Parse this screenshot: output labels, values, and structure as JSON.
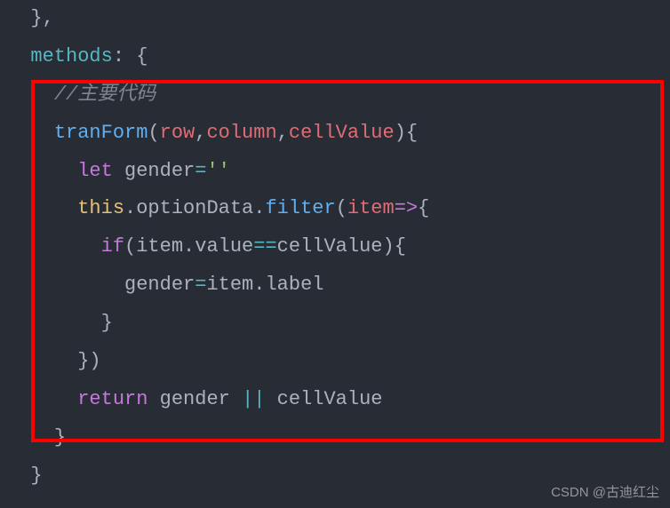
{
  "code": {
    "line0a": "  },",
    "line1": {
      "indent": "  ",
      "methods": "methods",
      "colon": ":",
      "brace": " {"
    },
    "line2": {
      "indent": "    ",
      "comment": "//主要代码"
    },
    "line3": {
      "indent": "    ",
      "func": "tranForm",
      "paren1": "(",
      "arg1": "row",
      "comma1": ",",
      "arg2": "column",
      "comma2": ",",
      "arg3": "cellValue",
      "paren2": "){"
    },
    "line4": {
      "indent": "      ",
      "let": "let",
      "sp": " ",
      "var": "gender",
      "eq": "=",
      "str": "''"
    },
    "line5": {
      "indent": "      ",
      "this": "this",
      "dot1": ".",
      "prop1": "optionData",
      "dot2": ".",
      "filter": "filter",
      "paren1": "(",
      "item": "item",
      "arrow": "=>",
      "brace": "{"
    },
    "line6": {
      "indent": "        ",
      "if": "if",
      "paren1": "(",
      "item": "item",
      "dot": ".",
      "value": "value",
      "eq": "==",
      "cell": "cellValue",
      "paren2": "){"
    },
    "line7": {
      "indent": "          ",
      "gender": "gender",
      "eq": "=",
      "item": "item",
      "dot": ".",
      "label": "label"
    },
    "line8": {
      "indent": "        ",
      "brace": "}"
    },
    "line9": {
      "indent": "      ",
      "close": "})"
    },
    "line10": {
      "indent": "      ",
      "return": "return",
      "sp": " ",
      "gender": "gender ",
      "or": "||",
      "cell": " cellValue"
    },
    "line11": {
      "indent": "    ",
      "brace": "}"
    },
    "line12": {
      "indent": "  ",
      "brace": "}"
    }
  },
  "watermark": "CSDN @古迪红尘"
}
